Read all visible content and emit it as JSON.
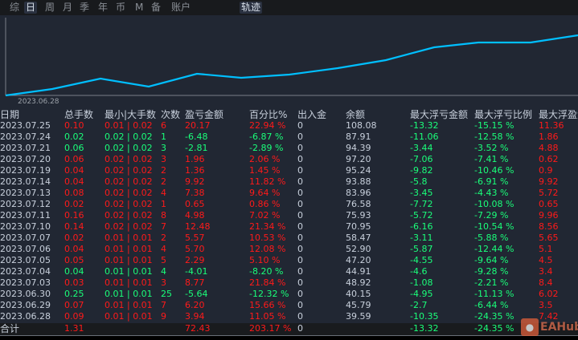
{
  "tabs": [
    "综",
    "日",
    "周",
    "月",
    "季",
    "年",
    "币",
    "M",
    "备",
    "账户",
    "轨迹"
  ],
  "active_tab": "日",
  "chart": {
    "x_start_label": "2023.06.28",
    "line_color": "#00bfff"
  },
  "columns": [
    "日期",
    "总手数",
    "最小|大手数",
    "次数",
    "盈亏金额",
    "百分比%",
    "出入金",
    "余额",
    "最大浮亏金额",
    "最大浮亏比例",
    "最大浮盈金额"
  ],
  "rows": [
    [
      "2023.07.25",
      "0.10",
      "0.01 | 0.02",
      "6",
      "20.17",
      "22.94 %",
      "0",
      "108.08",
      "-13.32",
      "-15.15 %",
      "11.36",
      "r"
    ],
    [
      "2023.07.24",
      "0.02",
      "0.02 | 0.02",
      "1",
      "-6.48",
      "-6.87 %",
      "0",
      "87.91",
      "-11.06",
      "-12.58 %",
      "1.86",
      "g"
    ],
    [
      "2023.07.21",
      "0.06",
      "0.02 | 0.02",
      "3",
      "-2.81",
      "-2.89 %",
      "0",
      "94.39",
      "-3.44",
      "-3.52 %",
      "4.88",
      "g"
    ],
    [
      "2023.07.20",
      "0.06",
      "0.02 | 0.02",
      "3",
      "1.96",
      "2.06 %",
      "0",
      "97.20",
      "-7.06",
      "-7.41 %",
      "0.62",
      "r"
    ],
    [
      "2023.07.19",
      "0.04",
      "0.02 | 0.02",
      "2",
      "1.36",
      "1.45 %",
      "0",
      "95.24",
      "-9.82",
      "-10.46 %",
      "0.9",
      "r"
    ],
    [
      "2023.07.14",
      "0.04",
      "0.02 | 0.02",
      "2",
      "9.92",
      "11.82 %",
      "0",
      "93.88",
      "-5.8",
      "-6.91 %",
      "9.92",
      "r"
    ],
    [
      "2023.07.13",
      "0.08",
      "0.02 | 0.02",
      "4",
      "7.38",
      "9.64 %",
      "0",
      "83.96",
      "-3.45",
      "-4.43 %",
      "5.72",
      "r"
    ],
    [
      "2023.07.12",
      "0.02",
      "0.02 | 0.02",
      "1",
      "0.65",
      "0.86 %",
      "0",
      "76.58",
      "-7.72",
      "-10.08 %",
      "0.65",
      "r"
    ],
    [
      "2023.07.11",
      "0.16",
      "0.02 | 0.02",
      "8",
      "4.98",
      "7.02 %",
      "0",
      "75.93",
      "-5.72",
      "-7.29 %",
      "9.96",
      "r"
    ],
    [
      "2023.07.10",
      "0.14",
      "0.02 | 0.02",
      "7",
      "12.48",
      "21.34 %",
      "0",
      "70.95",
      "-6.16",
      "-10.54 %",
      "8.56",
      "r"
    ],
    [
      "2023.07.07",
      "0.02",
      "0.01 | 0.01",
      "2",
      "5.57",
      "10.53 %",
      "0",
      "58.47",
      "-3.11",
      "-5.88 %",
      "5.65",
      "r"
    ],
    [
      "2023.07.06",
      "0.04",
      "0.01 | 0.01",
      "4",
      "5.70",
      "12.08 %",
      "0",
      "52.90",
      "-5.87",
      "-12.44 %",
      "5.1",
      "r"
    ],
    [
      "2023.07.05",
      "0.05",
      "0.01 | 0.01",
      "5",
      "2.29",
      "5.10 %",
      "0",
      "47.20",
      "-4.55",
      "-9.64 %",
      "4.5",
      "r"
    ],
    [
      "2023.07.04",
      "0.04",
      "0.01 | 0.01",
      "4",
      "-4.01",
      "-8.20 %",
      "0",
      "44.91",
      "-4.6",
      "-9.28 %",
      "3.4",
      "g"
    ],
    [
      "2023.07.03",
      "0.03",
      "0.01 | 0.01",
      "3",
      "8.77",
      "21.84 %",
      "0",
      "48.92",
      "-1.08",
      "-2.21 %",
      "8.4",
      "r"
    ],
    [
      "2023.06.30",
      "0.25",
      "0.01 | 0.01",
      "25",
      "-5.64",
      "-12.32 %",
      "0",
      "40.15",
      "-4.95",
      "-11.13 %",
      "6.02",
      "g"
    ],
    [
      "2023.06.29",
      "0.07",
      "0.01 | 0.01",
      "7",
      "6.20",
      "15.66 %",
      "0",
      "45.79",
      "-2.7",
      "-6.44 %",
      "3.5",
      "r"
    ],
    [
      "2023.06.28",
      "0.09",
      "0.01 | 0.01",
      "9",
      "3.94",
      "11.05 %",
      "0",
      "39.59",
      "-10.35",
      "-24.35 %",
      "7.42",
      "r"
    ]
  ],
  "total": {
    "label": "合计",
    "lots": "1.31",
    "pnl": "72.43",
    "pct": "203.17 %",
    "inout": "0",
    "max_float_loss": "-13.32",
    "max_float_loss_pct": "-24.35 %"
  },
  "watermark": "EAHub"
}
